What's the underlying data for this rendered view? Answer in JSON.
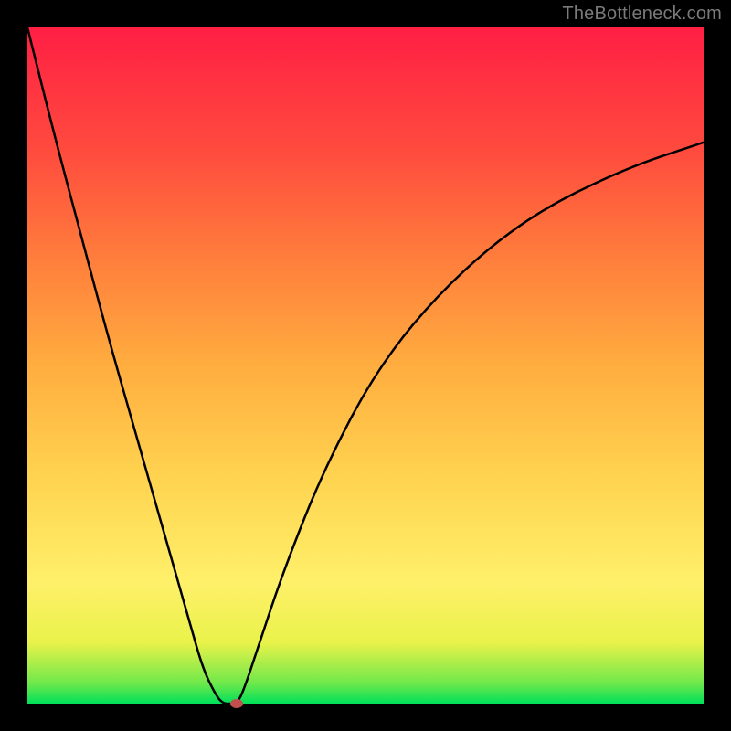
{
  "attribution": "TheBottleneck.com",
  "colors": {
    "background": "#000000",
    "gradient_top": "#ff1f44",
    "gradient_bottom": "#00e05a",
    "curve": "#000000",
    "dot": "#c0504d"
  },
  "chart_data": {
    "type": "line",
    "title": "",
    "xlabel": "",
    "ylabel": "",
    "xlim": [
      0,
      100
    ],
    "ylim": [
      0,
      100
    ],
    "grid": false,
    "legend": false,
    "x": [
      0,
      4,
      8,
      12,
      16,
      20,
      24,
      26,
      28,
      29,
      30,
      31,
      32,
      34,
      38,
      44,
      52,
      62,
      74,
      88,
      100
    ],
    "values": [
      100,
      84,
      69,
      54,
      40,
      26,
      12,
      5,
      1,
      0,
      0,
      0,
      2,
      8,
      20,
      35,
      50,
      62,
      72,
      79,
      83
    ],
    "minimum_point": {
      "x_fraction": 0.3,
      "y_fraction": 0.0
    },
    "marker": {
      "x_fraction": 0.31,
      "y_fraction": 0.0
    }
  }
}
